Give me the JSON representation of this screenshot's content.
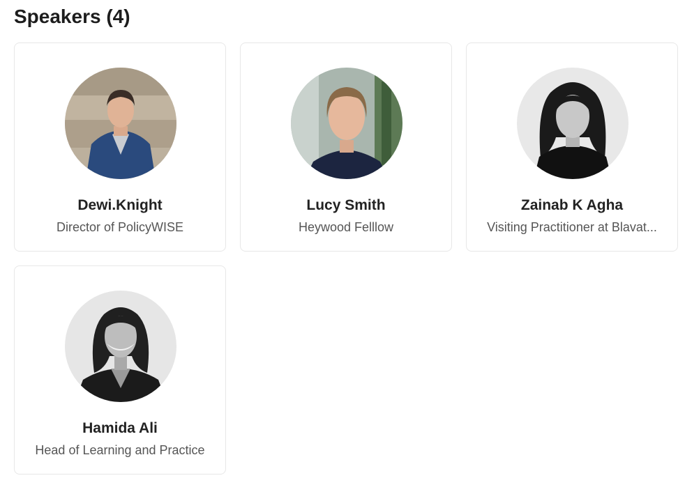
{
  "page": {
    "heading": "Speakers (4)"
  },
  "speakers": [
    {
      "name": "Dewi.Knight",
      "role": "Director of PolicyWISE",
      "photo": "speaker-photo"
    },
    {
      "name": "Lucy Smith",
      "role": "Heywood Felllow",
      "photo": "speaker-photo"
    },
    {
      "name": "Zainab K Agha",
      "role": "Visiting Practitioner at Blavat...",
      "photo": "speaker-photo"
    },
    {
      "name": "Hamida Ali",
      "role": "Head of Learning and Practice",
      "photo": "speaker-photo"
    }
  ],
  "colors": {
    "card_border": "#e7e7e7",
    "name_text": "#222222",
    "role_text": "#555555"
  }
}
